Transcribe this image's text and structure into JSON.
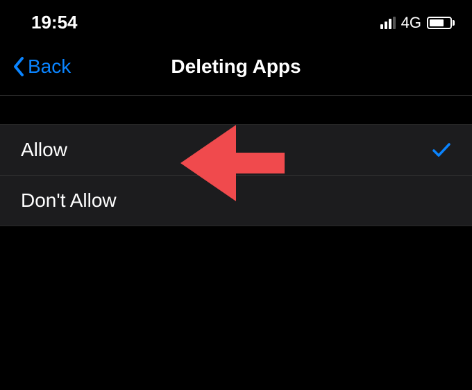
{
  "status_bar": {
    "time": "19:54",
    "network": "4G"
  },
  "nav": {
    "back_label": "Back",
    "title": "Deleting Apps"
  },
  "options": [
    {
      "label": "Allow",
      "selected": true
    },
    {
      "label": "Don't Allow",
      "selected": false
    }
  ],
  "colors": {
    "accent": "#0a84ff",
    "annotation": "#f04a4d"
  }
}
